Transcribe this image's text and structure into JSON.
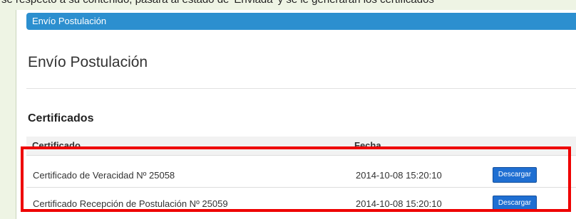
{
  "top_strip": {
    "text": "se respecto a su contenido, pasará al estado de 'Enviada' y se le generarán los certificados"
  },
  "header": {
    "bar_title": "Envío Postulación"
  },
  "page": {
    "title": "Envío Postulación"
  },
  "certificates": {
    "section_title": "Certificados",
    "columns": [
      "Certificado",
      "Fecha"
    ],
    "rows": [
      {
        "name": "Certificado de Veracidad Nº 25058",
        "date": "2014-10-08 15:20:10",
        "button": "Descargar"
      },
      {
        "name": "Certificado Recepción de Postulación Nº 25059",
        "date": "2014-10-08 15:20:10",
        "button": "Descargar"
      }
    ]
  },
  "colors": {
    "header_blue": "#2c8fcf",
    "button_blue": "#1f6fd2",
    "highlight_red": "#ee0000",
    "background_green": "#eef4e4"
  }
}
